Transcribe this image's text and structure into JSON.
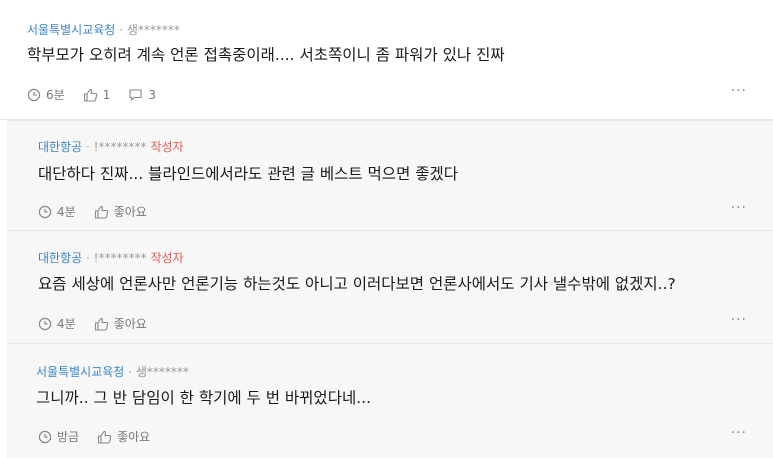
{
  "comments": [
    {
      "company": "서울특별시교육청",
      "nickname": "생*******",
      "author_tag": "",
      "text": "학부모가 오히려 계속 언론 접촉중이래.... 서초쪽이니 좀 파워가 있나 진짜",
      "time": "6분",
      "likes": "1",
      "replies": "3"
    },
    {
      "company": "대한항공",
      "nickname": "!********",
      "author_tag": "작성자",
      "text": "대단하다 진짜... 블라인드에서라도 관련 글 베스트 먹으면 좋겠다",
      "time": "4분",
      "like_label": "좋아요"
    },
    {
      "company": "대한항공",
      "nickname": "!********",
      "author_tag": "작성자",
      "text": "요즘 세상에 언론사만 언론기능 하는것도 아니고 이러다보면 언론사에서도 기사 낼수밖에 없겠지..?",
      "time": "4분",
      "like_label": "좋아요"
    },
    {
      "company": "서울특별시교육청",
      "nickname": "생*******",
      "author_tag": "",
      "text": "그니까.. 그 반 담임이 한 학기에 두 번 바뀌었다네...",
      "time": "방금",
      "like_label": "좋아요"
    }
  ],
  "separator": "·",
  "more_label": "···",
  "icons": {
    "clock": "clock-icon",
    "like": "thumbs-up-icon",
    "comment": "speech-bubble-icon",
    "more": "more-icon"
  },
  "colors": {
    "company": "#3b86c9",
    "author_tag": "#e0605a",
    "reply_bg": "#f7f7f7"
  }
}
